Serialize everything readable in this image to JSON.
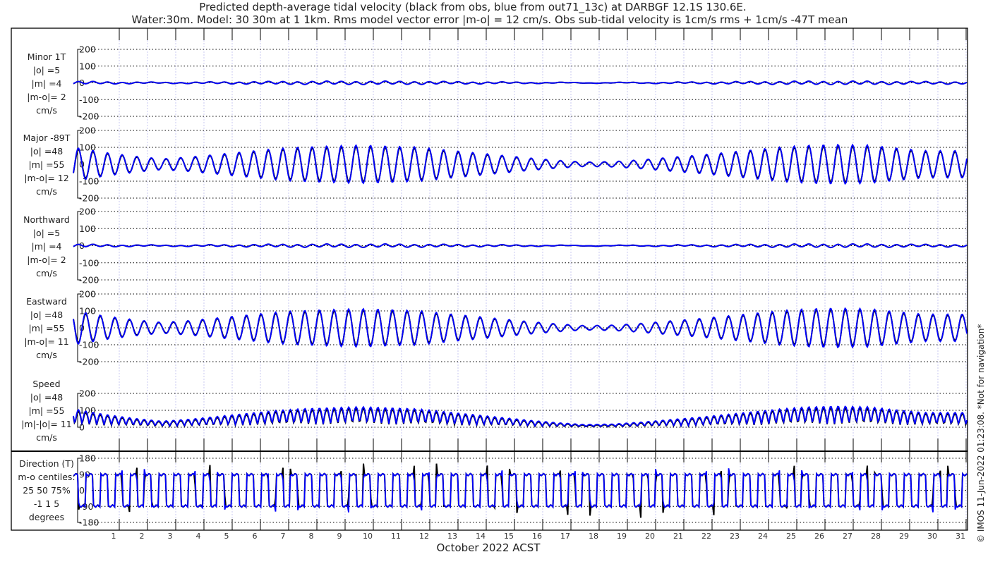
{
  "title_line1": "Predicted depth-average tidal velocity (black from obs, blue from out71_13c) at DARBGF 12.1S 130.6E.",
  "title_line2": "Water:30m. Model: 30 30m at 1 1km. Rms model vector error |m-o| = 12 cm/s. Obs sub-tidal velocity is 1cm/s rms + 1cm/s -47T mean",
  "copyright": "© IMOS 11-Jun-2022 01:23:08. *Not for navigation*",
  "colors": {
    "obs": "#000000",
    "model": "#0000ff",
    "day_grid": "#c8c8f0"
  },
  "chart_data": {
    "type": "line",
    "xlabel": "October 2022 ACST",
    "x_ticks": [
      "1",
      "2",
      "3",
      "4",
      "5",
      "6",
      "7",
      "8",
      "9",
      "10",
      "11",
      "12",
      "13",
      "14",
      "15",
      "16",
      "17",
      "18",
      "19",
      "20",
      "21",
      "22",
      "23",
      "24",
      "25",
      "26",
      "27",
      "28",
      "29",
      "30",
      "31"
    ],
    "series_legend": [
      "black from obs",
      "blue from out71_13c"
    ],
    "daily_tidal_amplitude_major_cms": [
      90,
      65,
      45,
      30,
      40,
      55,
      70,
      85,
      95,
      100,
      105,
      100,
      95,
      80,
      65,
      50,
      35,
      22,
      12,
      15,
      25,
      38,
      50,
      65,
      80,
      95,
      105,
      108,
      105,
      90,
      75
    ],
    "panels": [
      {
        "name": "minor",
        "label": [
          "Minor 1T",
          "|o| =5",
          "|m| =4",
          "|m-o|= 2",
          "cm/s"
        ],
        "yticks": [
          "200",
          "100",
          "0",
          "-100",
          "-200"
        ],
        "ylim": [
          -200,
          200
        ],
        "rel_amp": 0.08
      },
      {
        "name": "major",
        "label": [
          "Major -89T",
          "|o| =48",
          "|m| =55",
          "|m-o|= 12",
          "cm/s"
        ],
        "yticks": [
          "200",
          "100",
          "0",
          "-100",
          "-200"
        ],
        "ylim": [
          -200,
          200
        ],
        "rel_amp": 1.0
      },
      {
        "name": "northward",
        "label": [
          "Northward",
          "|o| =5",
          "|m| =4",
          "|m-o|= 2",
          "cm/s"
        ],
        "yticks": [
          "200",
          "100",
          "0",
          "-100",
          "-200"
        ],
        "ylim": [
          -200,
          200
        ],
        "rel_amp": 0.08
      },
      {
        "name": "eastward",
        "label": [
          "Eastward",
          "|o| =48",
          "|m| =55",
          "|m-o|= 11",
          "cm/s"
        ],
        "yticks": [
          "200",
          "100",
          "0",
          "-100",
          "-200"
        ],
        "ylim": [
          -200,
          200
        ],
        "rel_amp": -1.0
      },
      {
        "name": "speed",
        "label": [
          "Speed",
          "|o| =48",
          "|m| =55",
          "|m|-|o|= 11",
          "cm/s"
        ],
        "yticks": [
          "200",
          "100",
          "0"
        ],
        "ylim": [
          0,
          200
        ],
        "rel_amp": 1.0
      },
      {
        "name": "direction",
        "label": [
          "Direction (T)",
          "m-o centiles:",
          "25  50  75%",
          "-1  1  5",
          "degrees"
        ],
        "yticks": [
          "180",
          "90",
          "0",
          "-90",
          "-180"
        ],
        "ylim": [
          -180,
          180
        ],
        "rel_amp": 90
      }
    ]
  }
}
